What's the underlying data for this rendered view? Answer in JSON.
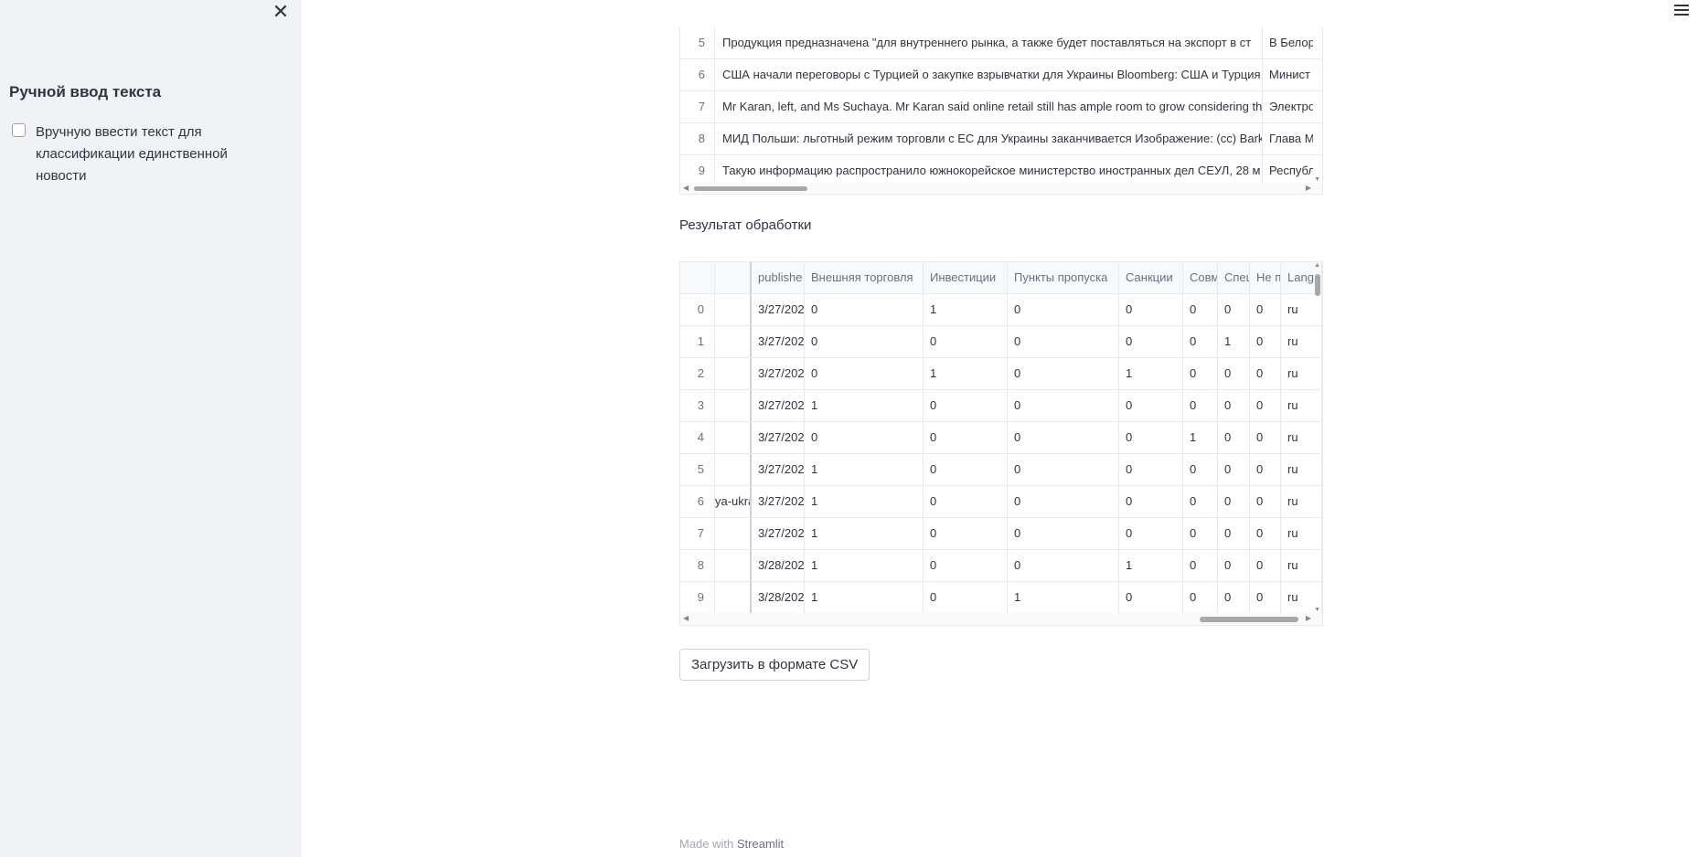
{
  "sidebar": {
    "close_icon": "close-icon",
    "title": "Ручной ввод текста",
    "checkbox_label": "Вручную ввести текст для классификации единственной новости",
    "checkbox_checked": false
  },
  "top_table": {
    "rows": [
      {
        "idx": "5",
        "text": "Продукция предназначена \"для внутреннего рынка, а также будет поставляться на экспорт в ст",
        "extra": "В Белор"
      },
      {
        "idx": "6",
        "text": "США начали переговоры с Турцией о закупке взрывчатки для Украины Bloomberg: США и Турция",
        "extra": "Минист"
      },
      {
        "idx": "7",
        "text": "Mr Karan, left, and Ms Suchaya. Mr Karan said online retail still has ample room to grow considering the",
        "extra": "Электро"
      },
      {
        "idx": "8",
        "text": "МИД Польши: льготный режим торговли с ЕС для Украины заканчивается Изображение: (cc) Bark",
        "extra": "Глава М"
      },
      {
        "idx": "9",
        "text": "Такую информацию распространило южнокорейское министерство иностранных дел СЕУЛ, 28 м",
        "extra": "Республ"
      }
    ]
  },
  "result": {
    "label": "Результат обработки",
    "columns": [
      "",
      "",
      "publishe",
      "Внешняя торговля",
      "Инвестиции",
      "Пункты пропуска",
      "Санкции",
      "Совм",
      "Спец",
      "Не п",
      "Lang"
    ],
    "rows": [
      {
        "idx": "0",
        "link": "",
        "date": "3/27/202",
        "v": [
          "0",
          "1",
          "0",
          "0",
          "0",
          "0",
          "0"
        ],
        "lang": "ru"
      },
      {
        "idx": "1",
        "link": "",
        "date": "3/27/202",
        "v": [
          "0",
          "0",
          "0",
          "0",
          "0",
          "1",
          "0"
        ],
        "lang": "ru"
      },
      {
        "idx": "2",
        "link": "",
        "date": "3/27/202",
        "v": [
          "0",
          "1",
          "0",
          "1",
          "0",
          "0",
          "0"
        ],
        "lang": "ru"
      },
      {
        "idx": "3",
        "link": "",
        "date": "3/27/202",
        "v": [
          "1",
          "0",
          "0",
          "0",
          "0",
          "0",
          "0"
        ],
        "lang": "ru"
      },
      {
        "idx": "4",
        "link": "",
        "date": "3/27/202",
        "v": [
          "0",
          "0",
          "0",
          "0",
          "1",
          "0",
          "0"
        ],
        "lang": "ru"
      },
      {
        "idx": "5",
        "link": "",
        "date": "3/27/202",
        "v": [
          "1",
          "0",
          "0",
          "0",
          "0",
          "0",
          "0"
        ],
        "lang": "ru"
      },
      {
        "idx": "6",
        "link": "ya-ukra",
        "date": "3/27/202",
        "v": [
          "1",
          "0",
          "0",
          "0",
          "0",
          "0",
          "0"
        ],
        "lang": "ru"
      },
      {
        "idx": "7",
        "link": "",
        "date": "3/27/202",
        "v": [
          "1",
          "0",
          "0",
          "0",
          "0",
          "0",
          "0"
        ],
        "lang": "ru"
      },
      {
        "idx": "8",
        "link": "",
        "date": "3/28/202",
        "v": [
          "1",
          "0",
          "0",
          "1",
          "0",
          "0",
          "0"
        ],
        "lang": "ru"
      },
      {
        "idx": "9",
        "link": "",
        "date": "3/28/202",
        "v": [
          "1",
          "0",
          "1",
          "0",
          "0",
          "0",
          "0"
        ],
        "lang": "ru"
      }
    ]
  },
  "download_button": "Загрузить в формате CSV",
  "footer": {
    "prefix": "Made with",
    "brand": "Streamlit"
  },
  "menu_icon": "hamburger-menu-icon"
}
